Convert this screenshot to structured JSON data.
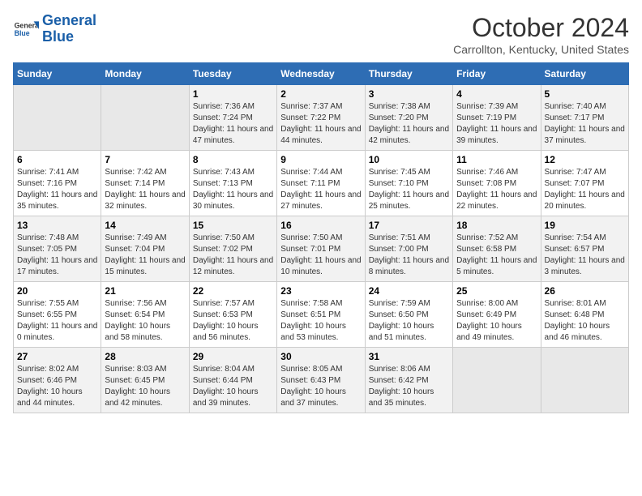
{
  "logo": {
    "line1": "General",
    "line2": "Blue"
  },
  "title": "October 2024",
  "location": "Carrollton, Kentucky, United States",
  "weekdays": [
    "Sunday",
    "Monday",
    "Tuesday",
    "Wednesday",
    "Thursday",
    "Friday",
    "Saturday"
  ],
  "weeks": [
    [
      {
        "day": "",
        "content": ""
      },
      {
        "day": "",
        "content": ""
      },
      {
        "day": "1",
        "content": "Sunrise: 7:36 AM\nSunset: 7:24 PM\nDaylight: 11 hours and 47 minutes."
      },
      {
        "day": "2",
        "content": "Sunrise: 7:37 AM\nSunset: 7:22 PM\nDaylight: 11 hours and 44 minutes."
      },
      {
        "day": "3",
        "content": "Sunrise: 7:38 AM\nSunset: 7:20 PM\nDaylight: 11 hours and 42 minutes."
      },
      {
        "day": "4",
        "content": "Sunrise: 7:39 AM\nSunset: 7:19 PM\nDaylight: 11 hours and 39 minutes."
      },
      {
        "day": "5",
        "content": "Sunrise: 7:40 AM\nSunset: 7:17 PM\nDaylight: 11 hours and 37 minutes."
      }
    ],
    [
      {
        "day": "6",
        "content": "Sunrise: 7:41 AM\nSunset: 7:16 PM\nDaylight: 11 hours and 35 minutes."
      },
      {
        "day": "7",
        "content": "Sunrise: 7:42 AM\nSunset: 7:14 PM\nDaylight: 11 hours and 32 minutes."
      },
      {
        "day": "8",
        "content": "Sunrise: 7:43 AM\nSunset: 7:13 PM\nDaylight: 11 hours and 30 minutes."
      },
      {
        "day": "9",
        "content": "Sunrise: 7:44 AM\nSunset: 7:11 PM\nDaylight: 11 hours and 27 minutes."
      },
      {
        "day": "10",
        "content": "Sunrise: 7:45 AM\nSunset: 7:10 PM\nDaylight: 11 hours and 25 minutes."
      },
      {
        "day": "11",
        "content": "Sunrise: 7:46 AM\nSunset: 7:08 PM\nDaylight: 11 hours and 22 minutes."
      },
      {
        "day": "12",
        "content": "Sunrise: 7:47 AM\nSunset: 7:07 PM\nDaylight: 11 hours and 20 minutes."
      }
    ],
    [
      {
        "day": "13",
        "content": "Sunrise: 7:48 AM\nSunset: 7:05 PM\nDaylight: 11 hours and 17 minutes."
      },
      {
        "day": "14",
        "content": "Sunrise: 7:49 AM\nSunset: 7:04 PM\nDaylight: 11 hours and 15 minutes."
      },
      {
        "day": "15",
        "content": "Sunrise: 7:50 AM\nSunset: 7:02 PM\nDaylight: 11 hours and 12 minutes."
      },
      {
        "day": "16",
        "content": "Sunrise: 7:50 AM\nSunset: 7:01 PM\nDaylight: 11 hours and 10 minutes."
      },
      {
        "day": "17",
        "content": "Sunrise: 7:51 AM\nSunset: 7:00 PM\nDaylight: 11 hours and 8 minutes."
      },
      {
        "day": "18",
        "content": "Sunrise: 7:52 AM\nSunset: 6:58 PM\nDaylight: 11 hours and 5 minutes."
      },
      {
        "day": "19",
        "content": "Sunrise: 7:54 AM\nSunset: 6:57 PM\nDaylight: 11 hours and 3 minutes."
      }
    ],
    [
      {
        "day": "20",
        "content": "Sunrise: 7:55 AM\nSunset: 6:55 PM\nDaylight: 11 hours and 0 minutes."
      },
      {
        "day": "21",
        "content": "Sunrise: 7:56 AM\nSunset: 6:54 PM\nDaylight: 10 hours and 58 minutes."
      },
      {
        "day": "22",
        "content": "Sunrise: 7:57 AM\nSunset: 6:53 PM\nDaylight: 10 hours and 56 minutes."
      },
      {
        "day": "23",
        "content": "Sunrise: 7:58 AM\nSunset: 6:51 PM\nDaylight: 10 hours and 53 minutes."
      },
      {
        "day": "24",
        "content": "Sunrise: 7:59 AM\nSunset: 6:50 PM\nDaylight: 10 hours and 51 minutes."
      },
      {
        "day": "25",
        "content": "Sunrise: 8:00 AM\nSunset: 6:49 PM\nDaylight: 10 hours and 49 minutes."
      },
      {
        "day": "26",
        "content": "Sunrise: 8:01 AM\nSunset: 6:48 PM\nDaylight: 10 hours and 46 minutes."
      }
    ],
    [
      {
        "day": "27",
        "content": "Sunrise: 8:02 AM\nSunset: 6:46 PM\nDaylight: 10 hours and 44 minutes."
      },
      {
        "day": "28",
        "content": "Sunrise: 8:03 AM\nSunset: 6:45 PM\nDaylight: 10 hours and 42 minutes."
      },
      {
        "day": "29",
        "content": "Sunrise: 8:04 AM\nSunset: 6:44 PM\nDaylight: 10 hours and 39 minutes."
      },
      {
        "day": "30",
        "content": "Sunrise: 8:05 AM\nSunset: 6:43 PM\nDaylight: 10 hours and 37 minutes."
      },
      {
        "day": "31",
        "content": "Sunrise: 8:06 AM\nSunset: 6:42 PM\nDaylight: 10 hours and 35 minutes."
      },
      {
        "day": "",
        "content": ""
      },
      {
        "day": "",
        "content": ""
      }
    ]
  ]
}
